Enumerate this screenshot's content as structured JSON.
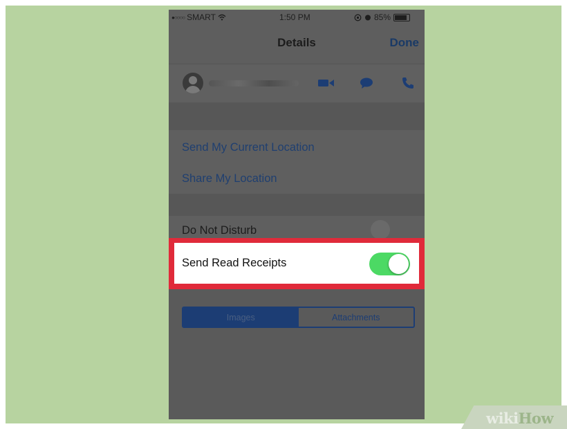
{
  "status_bar": {
    "signal_dots": "●○○○○",
    "carrier": "SMART",
    "time": "1:50 PM",
    "battery_percent": "85%"
  },
  "nav": {
    "title": "Details",
    "done_label": "Done"
  },
  "location": {
    "send_current": "Send My Current Location",
    "share": "Share My Location"
  },
  "settings": {
    "do_not_disturb": "Do Not Disturb",
    "do_not_disturb_on": false,
    "send_read_receipts": "Send Read Receipts",
    "send_read_receipts_on": true
  },
  "segmented": {
    "images": "Images",
    "attachments": "Attachments"
  },
  "colors": {
    "background": "#b7d3a0",
    "highlight": "#e02a3a",
    "toggle_on": "#4cd964",
    "ios_blue_dimmed": "#1c3d74"
  },
  "watermark": {
    "part1": "wiki",
    "part2": "How"
  }
}
